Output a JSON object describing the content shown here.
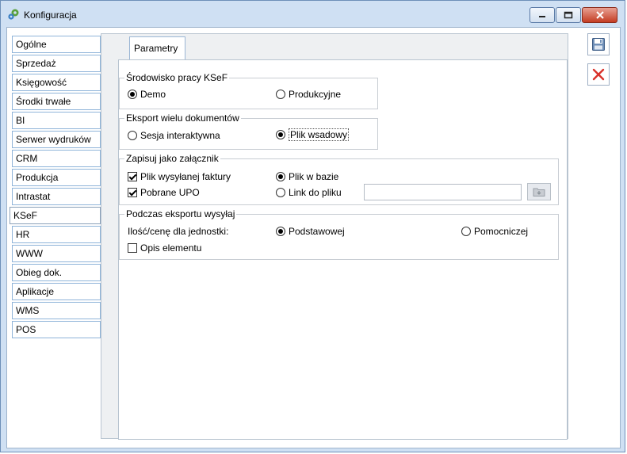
{
  "window": {
    "title": "Konfiguracja",
    "icons": {
      "app": "gear-app-icon",
      "minimize": "minimize-icon",
      "maximize": "maximize-icon",
      "close": "close-icon"
    }
  },
  "sidebar": {
    "items": [
      {
        "label": "Ogólne"
      },
      {
        "label": "Sprzedaż"
      },
      {
        "label": "Księgowość"
      },
      {
        "label": "Środki trwałe"
      },
      {
        "label": "BI"
      },
      {
        "label": "Serwer wydruków"
      },
      {
        "label": "CRM"
      },
      {
        "label": "Produkcja"
      },
      {
        "label": "Intrastat"
      },
      {
        "label": "KSeF",
        "active": true
      },
      {
        "label": "HR"
      },
      {
        "label": "WWW"
      },
      {
        "label": "Obieg dok."
      },
      {
        "label": "Aplikacje"
      },
      {
        "label": "WMS"
      },
      {
        "label": "POS"
      }
    ]
  },
  "tab": {
    "label": "Parametry"
  },
  "groups": {
    "environment": {
      "title": "Środowisko pracy KSeF",
      "demo": "Demo",
      "production": "Produkcyjne",
      "selected": "Demo"
    },
    "export": {
      "title": "Eksport wielu dokumentów",
      "interactive": "Sesja interaktywna",
      "batch": "Plik wsadowy",
      "selected": "Plik wsadowy"
    },
    "attachment": {
      "title": "Zapisuj jako załącznik",
      "sent_invoice": "Plik wysyłanej faktury",
      "sent_invoice_checked": true,
      "received_upo": "Pobrane UPO",
      "received_upo_checked": true,
      "in_database": "Plik w bazie",
      "link_to_file": "Link do pliku",
      "selected": "Plik w bazie",
      "link_value": ""
    },
    "sending": {
      "title": "Podczas eksportu wysyłaj",
      "quantity_label": "Ilość/cenę dla jednostki:",
      "basic": "Podstawowej",
      "auxiliary": "Pomocniczej",
      "selected": "Podstawowej",
      "element_description": "Opis elementu",
      "element_description_checked": false
    }
  },
  "actions": {
    "save_icon": "save-icon",
    "cancel_icon": "cancel-icon"
  },
  "colors": {
    "window_bg": "#cfe0f3",
    "close_red": "#c43c22",
    "cancel_red": "#d9322b"
  }
}
